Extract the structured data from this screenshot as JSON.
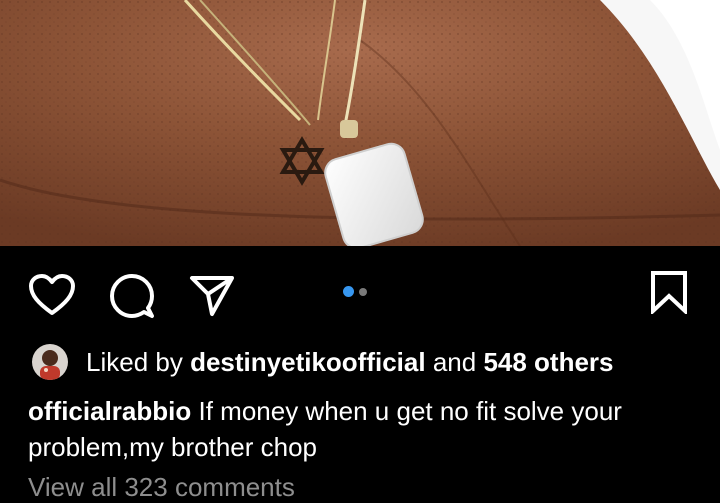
{
  "post": {
    "image_icon": "necklace-photo",
    "pager": {
      "count": 2,
      "active_index": 0
    },
    "actions": {
      "like_icon": "heart-icon",
      "comment_icon": "comment-icon",
      "share_icon": "send-icon",
      "save_icon": "bookmark-icon"
    },
    "likes": {
      "prefix": "Liked by",
      "liker": "destinyetikoofficial",
      "connector": "and",
      "others": "548 others"
    },
    "caption": {
      "username": "officialrabbio",
      "text": "If money when u get no fit solve your problem,my brother chop"
    },
    "view_comments": "View all 323 comments"
  },
  "colors": {
    "background": "#000000",
    "text": "#ffffff",
    "muted": "#8e8e8e",
    "active_dot": "#3797f0"
  }
}
